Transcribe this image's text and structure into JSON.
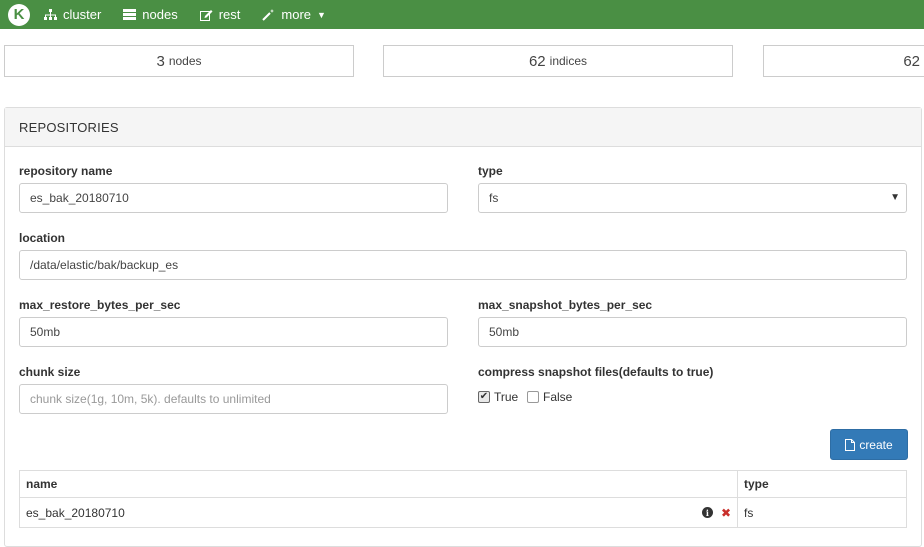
{
  "nav": {
    "logo": "K",
    "items": [
      {
        "label": "cluster",
        "icon": "sitemap-icon"
      },
      {
        "label": "nodes",
        "icon": "server-icon"
      },
      {
        "label": "rest",
        "icon": "edit-icon"
      },
      {
        "label": "more",
        "icon": "magic-wand-icon"
      }
    ]
  },
  "stats": [
    {
      "value": "3",
      "unit": "nodes"
    },
    {
      "value": "62",
      "unit": "indices"
    },
    {
      "value": "62"
    }
  ],
  "panel": {
    "title": "REPOSITORIES",
    "form": {
      "repo_name_label": "repository name",
      "repo_name_value": "es_bak_20180710",
      "type_label": "type",
      "type_value": "fs",
      "location_label": "location",
      "location_value": "/data/elastic/bak/backup_es",
      "max_restore_label": "max_restore_bytes_per_sec",
      "max_restore_value": "50mb",
      "max_snapshot_label": "max_snapshot_bytes_per_sec",
      "max_snapshot_value": "50mb",
      "chunk_label": "chunk size",
      "chunk_placeholder": "chunk size(1g, 10m, 5k). defaults to unlimited",
      "compress_label": "compress snapshot files(defaults to true)",
      "opt_true": "True",
      "opt_false": "False",
      "create_label": "create"
    },
    "table": {
      "headers": [
        "name",
        "type"
      ],
      "rows": [
        {
          "name": "es_bak_20180710",
          "type": "fs"
        }
      ]
    }
  },
  "colors": {
    "navbar": "#4a8f44",
    "primary_button": "#337ab7",
    "delete": "#c9302c"
  }
}
